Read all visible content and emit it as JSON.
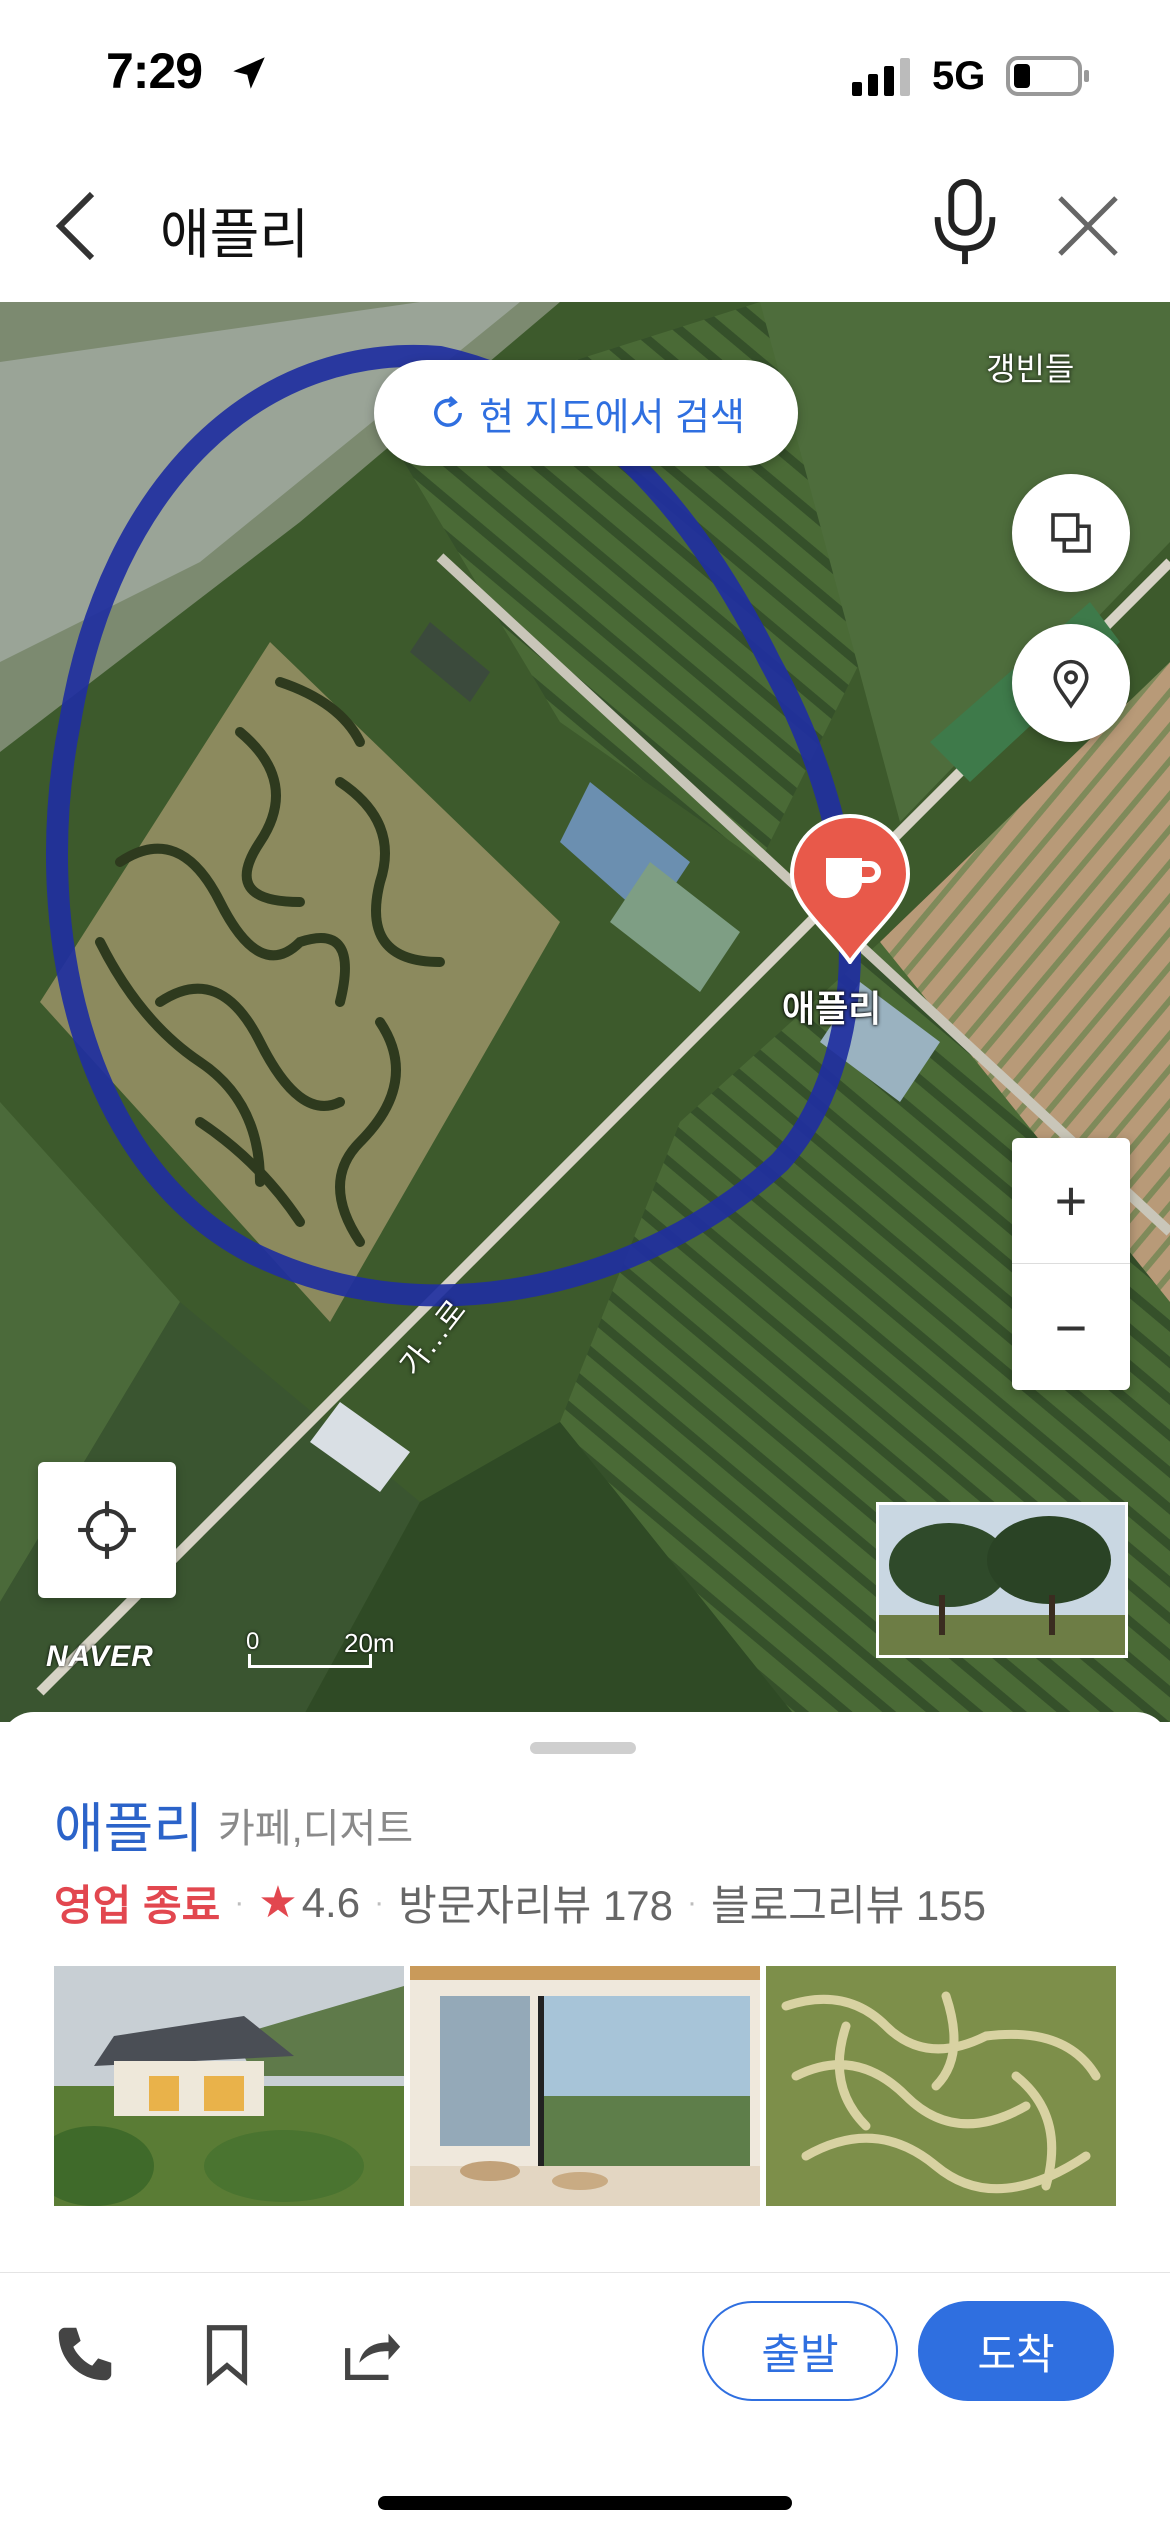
{
  "status_bar": {
    "time": "7:29",
    "network": "5G"
  },
  "search": {
    "query": "애플리"
  },
  "map": {
    "search_area_button": "현 지도에서 검색",
    "area_label": "갱빈들",
    "place_marker_label": "애플리",
    "road_label": "가…로",
    "logo": "NAVER",
    "scale_zero": "0",
    "scale_distance": "20m",
    "zoom_in": "+",
    "zoom_out": "−"
  },
  "place": {
    "name": "애플리",
    "category": "카페,디저트",
    "status": "영업 종료",
    "rating": "4.6",
    "visitor_reviews": "방문자리뷰 178",
    "blog_reviews": "블로그리뷰 155"
  },
  "actions": {
    "depart": "출발",
    "arrive": "도착"
  },
  "colors": {
    "accent": "#2f6fe0",
    "closed": "#e2474f",
    "marker": "#e8594a",
    "annotation": "#1f2fa0"
  }
}
